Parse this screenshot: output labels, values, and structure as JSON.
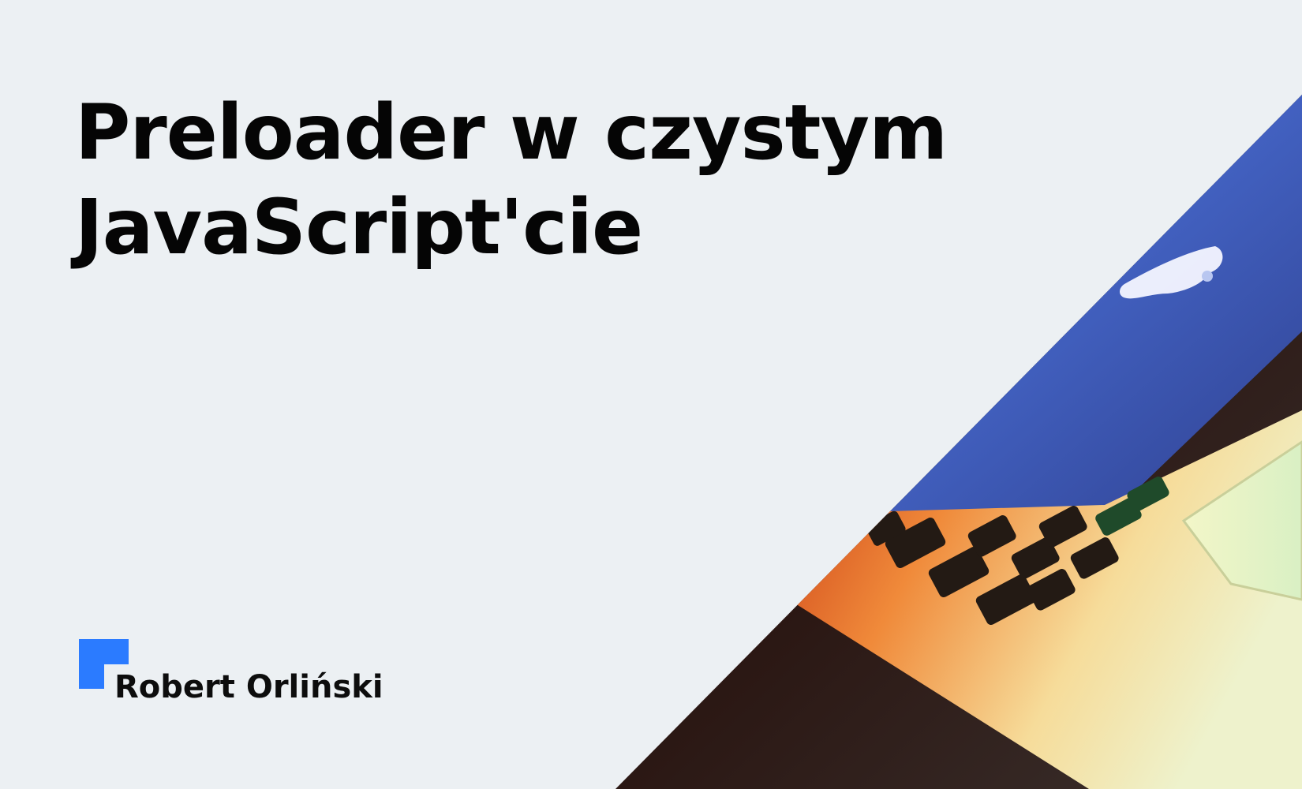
{
  "headline": {
    "line1": "Preloader w czystym",
    "line2": "JavaScript'cie"
  },
  "author": {
    "name": "Robert Orliński"
  },
  "colors": {
    "background": "#ecf0f3",
    "text": "#050505",
    "logo_accent": "#2b7bff"
  },
  "image": {
    "subject": "laptop-photo"
  }
}
